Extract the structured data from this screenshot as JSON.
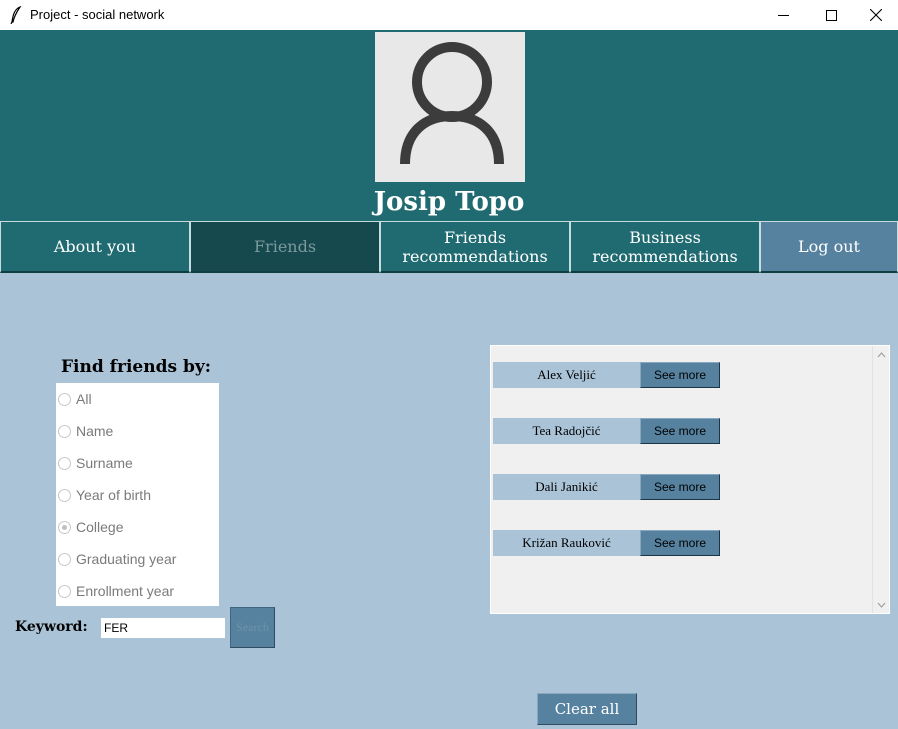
{
  "window": {
    "title": "Project - social network",
    "app_icon": "feather-icon",
    "controls": [
      "minimize-icon",
      "maximize-icon",
      "close-icon"
    ]
  },
  "profile": {
    "name": "Josip Topo",
    "avatar_icon": "user-silhouette-icon"
  },
  "nav": {
    "about": "About you",
    "friends": "Friends",
    "friends_recommendations_line1": "Friends",
    "friends_recommendations_line2": "recommendations",
    "business_recommendations_line1": "Business",
    "business_recommendations_line2": "recommendations",
    "logout": "Log out",
    "active": "Friends"
  },
  "search": {
    "heading": "Find friends by:",
    "options": [
      "All",
      "Name",
      "Surname",
      "Year of birth",
      "College",
      "Graduating year",
      "Enrollment year"
    ],
    "selected": "College",
    "keyword_label": "Keyword:",
    "keyword_value": "FER",
    "search_button": "Search"
  },
  "results": {
    "items": [
      {
        "name": "Alex Veljić",
        "button": "See more"
      },
      {
        "name": "Tea Radojčić",
        "button": "See more"
      },
      {
        "name": "Dali Janikić",
        "button": "See more"
      },
      {
        "name": "Križan Rauković",
        "button": "See more"
      }
    ]
  },
  "actions": {
    "clear_all": "Clear all"
  },
  "colors": {
    "header_bg": "#206b71",
    "nav_active_bg": "#15494e",
    "content_bg": "#aac3d7",
    "button_bg": "#56829f"
  }
}
